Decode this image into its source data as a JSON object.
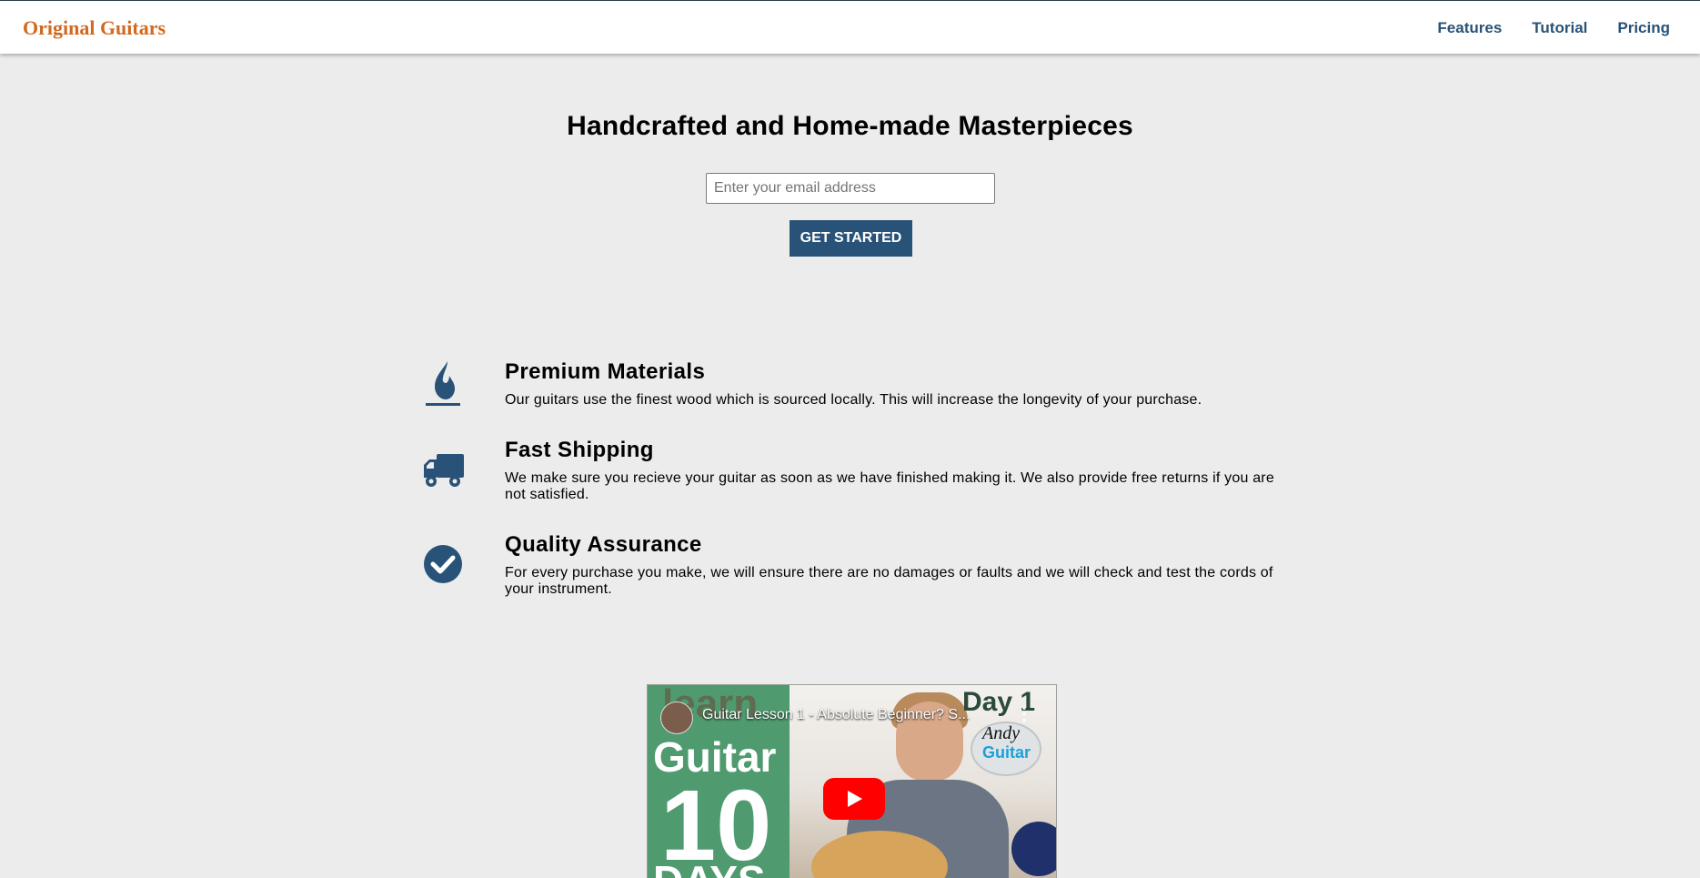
{
  "brand": {
    "name": "Original Guitars",
    "color": "#d2691e"
  },
  "nav": {
    "links": [
      {
        "label": "Features"
      },
      {
        "label": "Tutorial"
      },
      {
        "label": "Pricing"
      }
    ],
    "link_color": "#285277"
  },
  "hero": {
    "title": "Handcrafted and Home-made Masterpieces",
    "email_placeholder": "Enter your email address",
    "email_value": "",
    "cta_label": "GET STARTED",
    "cta_color": "#285277"
  },
  "features": [
    {
      "icon": "fire-icon",
      "title": "Premium Materials",
      "text": "Our guitars use the finest wood which is sourced locally. This will increase the longevity of your purchase."
    },
    {
      "icon": "truck-icon",
      "title": "Fast Shipping",
      "text": "We make sure you recieve your guitar as soon as we have finished making it. We also provide free returns if you are not satisfied."
    },
    {
      "icon": "check-circle-icon",
      "title": "Quality Assurance",
      "text": "For every purchase you make, we will ensure there are no damages or faults and we will check and test the cords of your instrument."
    }
  ],
  "video": {
    "title": "Guitar Lesson 1 - Absolute Beginner? S...",
    "thumb_text_learn": "learn",
    "thumb_text_guitar": "Guitar",
    "thumb_text_number": "10",
    "thumb_text_days": "DAYS",
    "thumb_text_day1": "Day 1",
    "badge_line1": "Andy",
    "badge_line2": "Guitar",
    "play_icon": "youtube-play-icon",
    "menu_icon": "more-vertical-icon"
  },
  "colors": {
    "background": "#ececec",
    "icon": "#285277"
  }
}
